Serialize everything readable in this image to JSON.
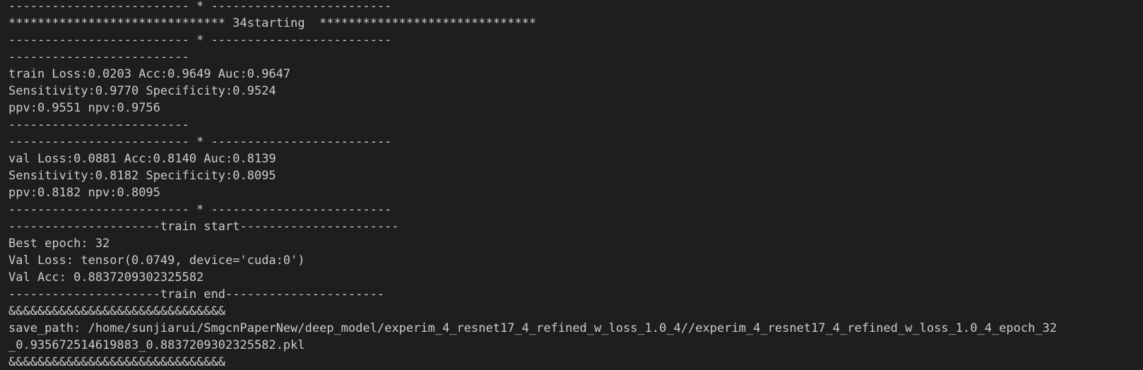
{
  "terminal": {
    "lines": [
      "------------------------- * -------------------------",
      "****************************** 34starting  ******************************",
      "------------------------- * -------------------------",
      "-------------------------",
      "train Loss:0.0203 Acc:0.9649 Auc:0.9647",
      "Sensitivity:0.9770 Specificity:0.9524",
      "ppv:0.9551 npv:0.9756",
      "-------------------------",
      "------------------------- * -------------------------",
      "val Loss:0.0881 Acc:0.8140 Auc:0.8139",
      "Sensitivity:0.8182 Specificity:0.8095",
      "ppv:0.8182 npv:0.8095",
      "------------------------- * -------------------------",
      "---------------------train start----------------------",
      "Best epoch: 32",
      "Val Loss: tensor(0.0749, device='cuda:0')",
      "Val Acc: 0.8837209302325582",
      "---------------------train end----------------------",
      "&&&&&&&&&&&&&&&&&&&&&&&&&&&&&&",
      "save_path: /home/sunjiarui/SmgcnPaperNew/deep_model/experim_4_resnet17_4_refined_w_loss_1.0_4//experim_4_resnet17_4_refined_w_loss_1.0_4_epoch_32",
      "_0.935672514619883_0.8837209302325582.pkl",
      "&&&&&&&&&&&&&&&&&&&&&&&&&&&&&&"
    ]
  }
}
